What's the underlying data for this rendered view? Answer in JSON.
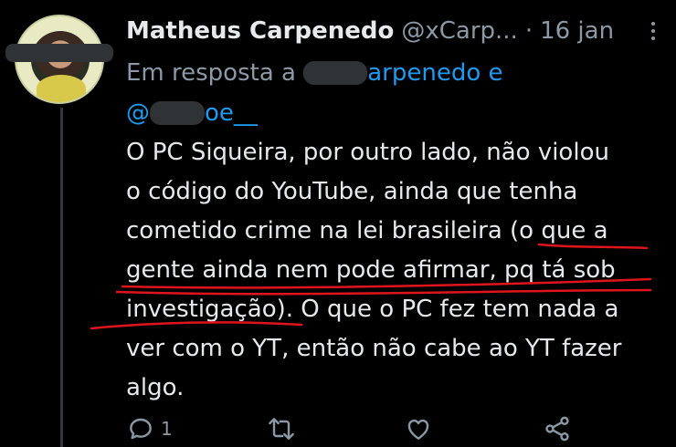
{
  "tweet": {
    "author_name": "Matheus Carpenedo",
    "author_handle": "@xCarp...",
    "separator": "·",
    "date": "16 jan",
    "reply_prefix": "Em resposta a",
    "reply_mention_1_visible": "arpenedo e",
    "reply_mention_2_visible": "oe__",
    "reply_mention_2_prefix": "@",
    "body_lines": [
      "O PC Siqueira, por outro lado, não violou",
      "o código do YouTube, ainda que tenha",
      "cometido crime na lei brasileira (o que a",
      "gente ainda nem pode afirmar, pq tá sob",
      "investigação). O que o PC fez tem nada a",
      "ver com o YT, então não cabe ao YT fazer",
      "algo."
    ],
    "reply_count": "1"
  },
  "icons": {
    "more": "more-vertical-icon",
    "reply": "reply-bubble-icon",
    "retweet": "retweet-icon",
    "like": "heart-icon",
    "share": "share-icon"
  },
  "colors": {
    "background": "#000000",
    "text": "#e7e9ea",
    "muted": "#8b98a5",
    "link": "#1d9bf0",
    "annotation": "#e0141c"
  }
}
